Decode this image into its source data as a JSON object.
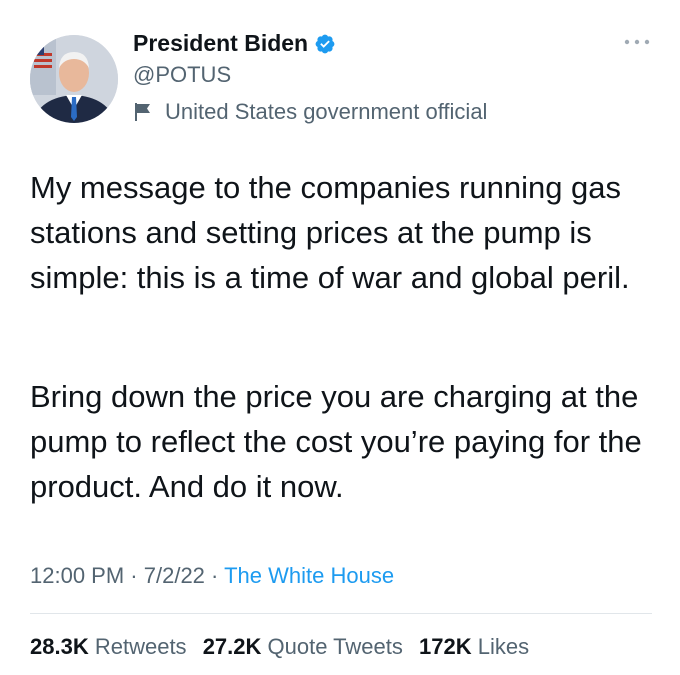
{
  "author": {
    "name": "President Biden",
    "handle": "@POTUS",
    "label": "United States government official"
  },
  "tweet": {
    "paragraphs": [
      "My message to the companies running gas stations and setting prices at the pump is simple: this is a time of war and global peril.",
      "Bring down the price you are charging at the pump to reflect the cost you’re paying for the product. And do it now."
    ]
  },
  "meta": {
    "time": "12:00 PM",
    "date": "7/2/22",
    "separator": "·",
    "source": "The White House"
  },
  "stats": {
    "retweets_count": "28.3K",
    "retweets_label": "Retweets",
    "quote_count": "27.2K",
    "quote_label": "Quote Tweets",
    "likes_count": "172K",
    "likes_label": "Likes"
  },
  "colors": {
    "accent": "#1d9bf0",
    "secondary_text": "#536471",
    "primary_text": "#0f1419"
  },
  "icons": [
    "verified-badge-icon",
    "flag-icon",
    "more-options-icon"
  ]
}
